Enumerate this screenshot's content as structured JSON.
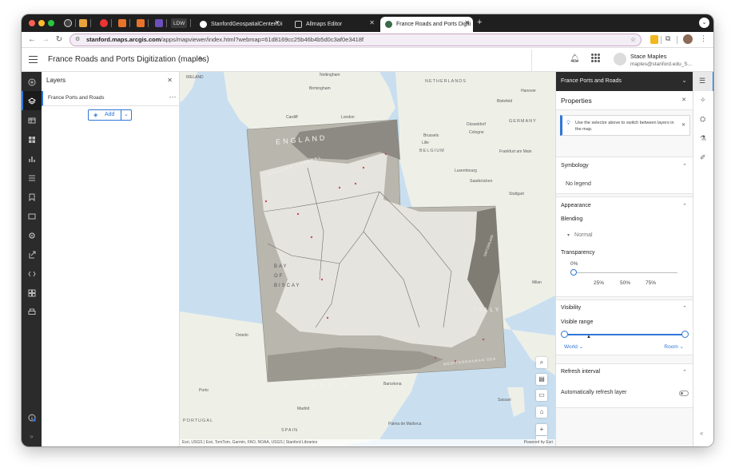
{
  "browser": {
    "pinned_tabs": [
      "app-icon",
      "chart-icon",
      "youtube-icon",
      "download-icon",
      "download-icon-2",
      "vsc-icon"
    ],
    "ldw_label": "LDW",
    "tabs": [
      {
        "label": "StanfordGeospatialCenter/Di",
        "icon": "github-icon"
      },
      {
        "label": "Allmaps Editor",
        "icon": "allmaps-icon"
      },
      {
        "label": "France Roads and Ports Digiti",
        "icon": "arcgis-icon",
        "active": true
      }
    ],
    "url_host": "stanford.maps.arcgis.com",
    "url_path": "/apps/mapviewer/index.html?webmap=61d8169cc25b46b4b5d0c3af0e3418f"
  },
  "app": {
    "title": "France Roads and Ports Digitization (maples)",
    "user_name": "Stace Maples",
    "user_email": "maples@stanford.edu_S..."
  },
  "layers_panel": {
    "title": "Layers",
    "layer_name": "France Ports and Roads",
    "add_label": "Add"
  },
  "map": {
    "labels": {
      "ireland": "IRELAND",
      "nottingham": "Nottingham",
      "netherlands": "NETHERLANDS",
      "hanover": "Hanover",
      "birmingham": "Birmingham",
      "bielefeld": "Bielefeld",
      "cardiff": "Cardiff",
      "london": "London",
      "dusseldorf": "Düsseldorf",
      "germany": "GERMANY",
      "cologne": "Cologne",
      "brussels": "Brussels",
      "belgium": "BELGIUM",
      "lille": "Lille",
      "frankfurt": "Frankfurt am Main",
      "luxembourg": "Luxembourg",
      "saarbrucken": "Saarbrücken",
      "stuttgart": "Stuttgart",
      "milan": "Milan",
      "oviedo": "Oviedo",
      "porto": "Porto",
      "barcelona": "Barcelona",
      "madrid": "Madrid",
      "sassari": "Sassari",
      "spain": "SPAIN",
      "portugal": "PORTUGAL",
      "palma": "Palma de Mallorca",
      "england": "ENGLAND",
      "english_channel": "ENGLISH CHANNEL",
      "bay_of_biscay": "BAY OF BISCAY",
      "italy": "ITALY",
      "mediterranean": "MEDITERRANEAN SEA",
      "spain_old": "SPAIN",
      "switzerland": "SWITZERLAND"
    },
    "attribution": "Esri, USGS | Esri, TomTom, Garmin, FAO, NOAA, USGS | Stanford Libraries",
    "powered_by": "Powered by Esri"
  },
  "properties": {
    "layer_selector": "France Ports and Roads",
    "title": "Properties",
    "tip": "Use the selector above to switch between layers in the map.",
    "symbology_label": "Symbology",
    "no_legend": "No legend",
    "appearance_label": "Appearance",
    "blending_label": "Blending",
    "blending_value": "Normal",
    "transparency_label": "Transparency",
    "transparency_value": "0%",
    "transparency_fraction": 0,
    "ticks": [
      "25%",
      "50%",
      "75%"
    ],
    "visibility_label": "Visibility",
    "visible_range_label": "Visible range",
    "range_min": "World",
    "range_max": "Room",
    "refresh_label": "Refresh interval",
    "auto_refresh_label": "Automatically refresh layer"
  }
}
